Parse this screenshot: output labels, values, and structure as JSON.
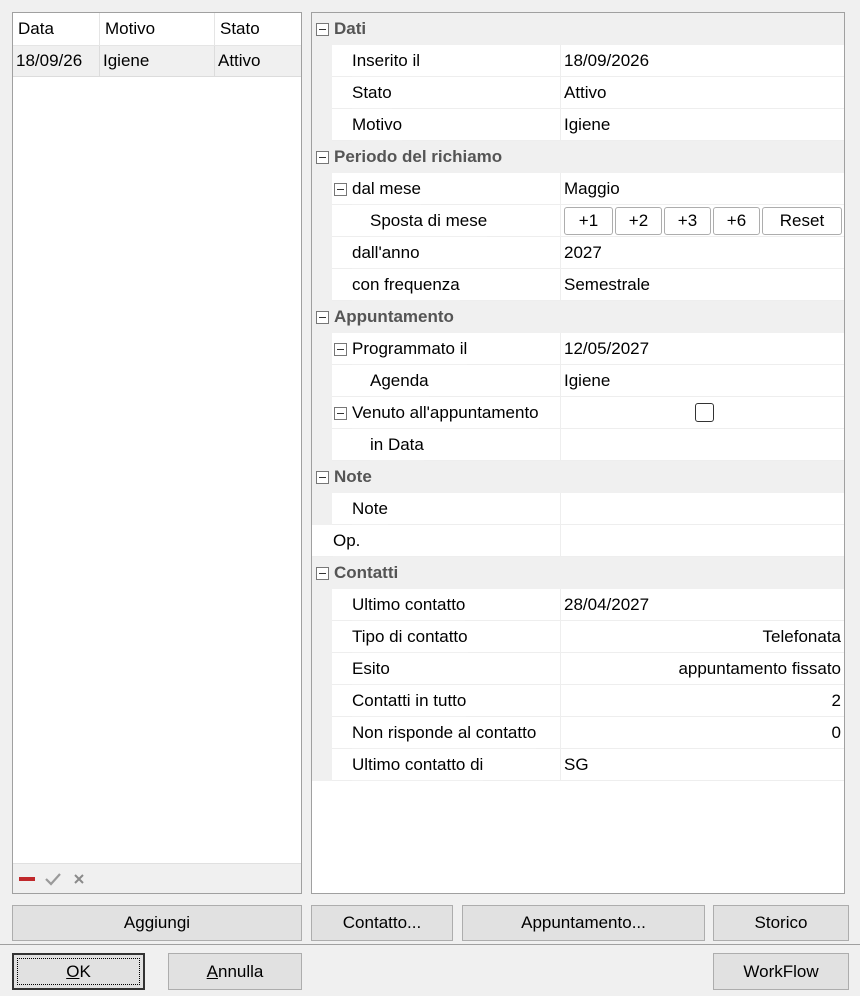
{
  "list": {
    "columns": [
      "Data",
      "Motivo",
      "Stato"
    ],
    "rows": [
      {
        "data": "18/09/26",
        "motivo": "Igiene",
        "stato": "Attivo"
      }
    ]
  },
  "grid": {
    "dati": {
      "title": "Dati",
      "inserito_label": "Inserito il",
      "inserito_value": "18/09/2026",
      "stato_label": "Stato",
      "stato_value": "Attivo",
      "motivo_label": "Motivo",
      "motivo_value": "Igiene"
    },
    "periodo": {
      "title": "Periodo del richiamo",
      "mese_label": "dal mese",
      "mese_value": "Maggio",
      "sposta_label": "Sposta  di mese",
      "btn_p1": "+1",
      "btn_p2": "+2",
      "btn_p3": "+3",
      "btn_p6": "+6",
      "btn_reset": "Reset",
      "anno_label": "dall'anno",
      "anno_value": "2027",
      "freq_label": "con frequenza",
      "freq_value": "Semestrale"
    },
    "appuntamento": {
      "title": "Appuntamento",
      "programmato_label": "Programmato il",
      "programmato_value": "12/05/2027",
      "agenda_label": "Agenda",
      "agenda_value": "Igiene",
      "venuto_label": "Venuto all'appuntamento",
      "indata_label": "in Data",
      "indata_value": ""
    },
    "note": {
      "title": "Note",
      "note_label": "Note",
      "note_value": "",
      "op_label": "Op.",
      "op_value": ""
    },
    "contatti": {
      "title": "Contatti",
      "ultimo_label": "Ultimo contatto",
      "ultimo_value": "28/04/2027",
      "tipo_label": "Tipo di contatto",
      "tipo_value": "Telefonata",
      "esito_label": "Esito",
      "esito_value": "appuntamento fissato",
      "tutto_label": "Contatti in tutto",
      "tutto_value": "2",
      "nonrisp_label": "Non risponde al contatto",
      "nonrisp_value": "0",
      "ultimodi_label": "Ultimo contatto di",
      "ultimodi_value": "SG"
    }
  },
  "buttons": {
    "aggiungi": "Aggiungi",
    "contatto": "Contatto...",
    "appuntamento": "Appuntamento...",
    "storico": "Storico",
    "ok_mnemonic": "O",
    "ok_rest": "K",
    "annulla_mnemonic": "A",
    "annulla_rest": "nnulla",
    "workflow": "WorkFlow"
  },
  "icons": {
    "delete": "minus-icon",
    "confirm": "check-icon",
    "cancel": "x-icon",
    "collapse": "collapse-box-icon"
  }
}
